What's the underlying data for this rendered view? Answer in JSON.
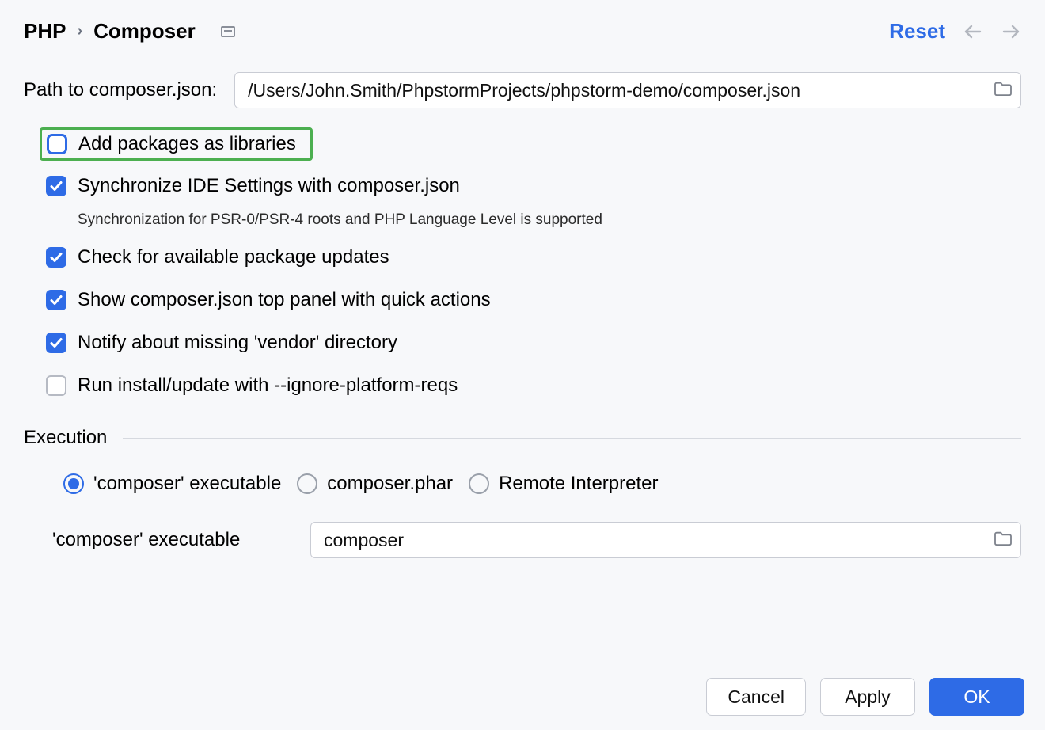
{
  "breadcrumb": {
    "root": "PHP",
    "current": "Composer"
  },
  "header": {
    "reset": "Reset"
  },
  "path": {
    "label": "Path to composer.json:",
    "value": "/Users/John.Smith/PhpstormProjects/phpstorm-demo/composer.json"
  },
  "checks": {
    "add_packages": "Add packages as libraries",
    "sync_ide": "Synchronize IDE Settings with composer.json",
    "sync_hint": "Synchronization for PSR-0/PSR-4 roots and PHP Language Level is supported",
    "check_updates": "Check for available package updates",
    "show_top_panel": "Show composer.json top panel with quick actions",
    "notify_vendor": "Notify about missing 'vendor' directory",
    "ignore_platform": "Run install/update with --ignore-platform-reqs"
  },
  "execution": {
    "title": "Execution",
    "radios": {
      "executable": "'composer' executable",
      "phar": "composer.phar",
      "remote": "Remote Interpreter"
    },
    "exec_label": "'composer' executable",
    "exec_value": "composer"
  },
  "footer": {
    "cancel": "Cancel",
    "apply": "Apply",
    "ok": "OK"
  }
}
